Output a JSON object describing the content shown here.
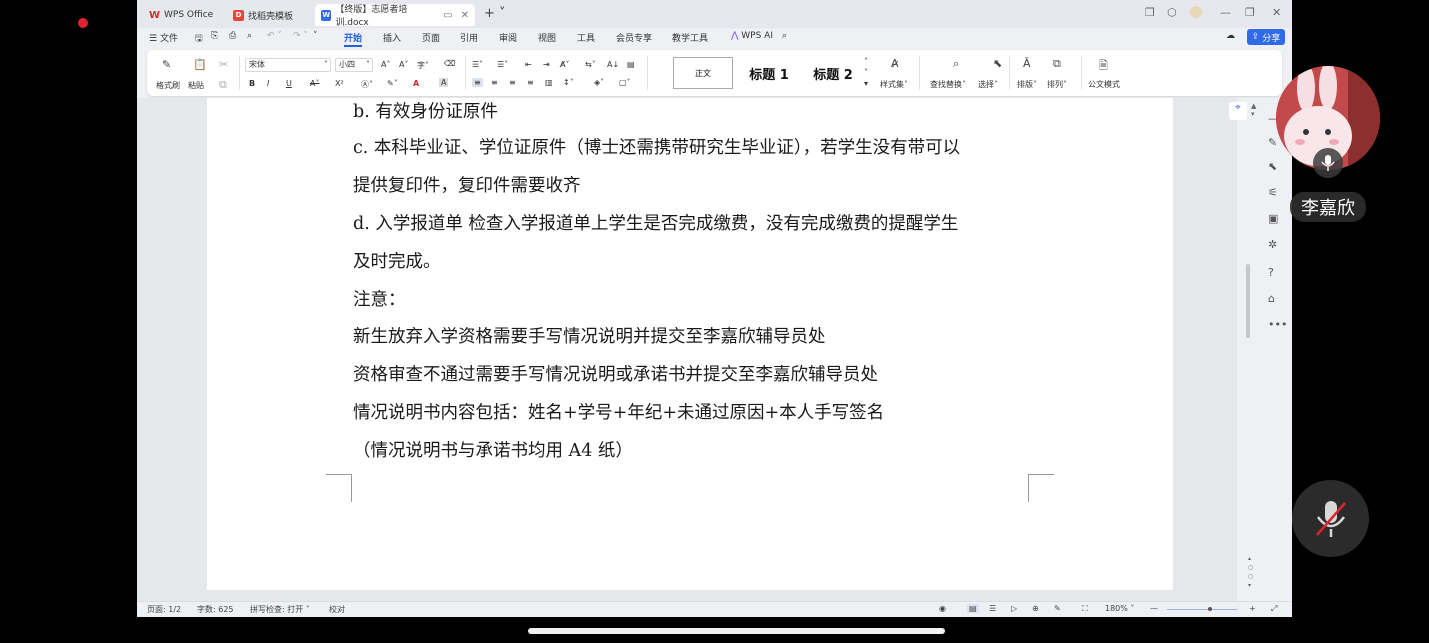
{
  "tabs": [
    {
      "label": "WPS Office",
      "icon": "wps-logo-icon"
    },
    {
      "label": "找稻壳模板",
      "icon": "docer-template-icon"
    },
    {
      "label": "【终版】志愿者培训.docx",
      "icon": "word-doc-icon",
      "active": true
    }
  ],
  "menu": {
    "file": "文件",
    "items": [
      "开始",
      "插入",
      "页面",
      "引用",
      "审阅",
      "视图",
      "工具",
      "会员专享",
      "教学工具"
    ],
    "active": "开始",
    "wps_ai": "WPS AI",
    "share": "分享"
  },
  "ribbon": {
    "format_painter": "格式刷",
    "paste": "粘贴",
    "font_name": "宋体",
    "font_size": "小四",
    "bold": "B",
    "italic": "I",
    "underline": "U",
    "superscript": "X²",
    "font_color": "A",
    "styles": {
      "normal": "正文",
      "h1": "标题 1",
      "h2": "标题 2"
    },
    "style_set": "样式集",
    "find_replace": "查找替换",
    "select": "选择",
    "layout": "排版",
    "arrange": "排列",
    "official_mode": "公文模式"
  },
  "document": {
    "lines": [
      "b. 有效身份证原件",
      "c. 本科毕业证、学位证原件（博士还需携带研究生毕业证），若学生没有带可以",
      "提供复印件，复印件需要收齐",
      "d. 入学报道单  检查入学报道单上学生是否完成缴费，没有完成缴费的提醒学生",
      "及时完成。",
      "注意：",
      "新生放弃入学资格需要手写情况说明并提交至李嘉欣辅导员处",
      "资格审查不通过需要手写情况说明或承诺书并提交至李嘉欣辅导员处",
      "情况说明书内容包括：姓名+学号+年纪+未通过原因+本人手写签名",
      "（情况说明书与承诺书均用 A4 纸）"
    ]
  },
  "status": {
    "page": "页面: 1/2",
    "word_count": "字数: 625",
    "spell_check": "拼写检查: 打开",
    "proofread": "校对",
    "zoom": "180%"
  },
  "overlay": {
    "participant_name": "李嘉欣"
  },
  "colors": {
    "accent": "#1c62d9",
    "share_button": "#2f6be9",
    "record_dot": "#e0242f",
    "wps_red": "#d6262f"
  }
}
